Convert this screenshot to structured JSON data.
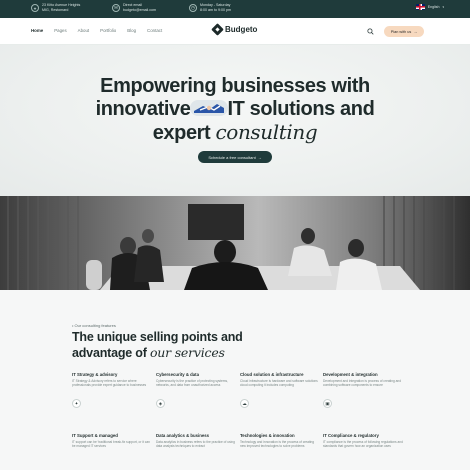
{
  "topbar": {
    "address_line1": "23 Kitto Avenue Heights",
    "address_line2": "MIG, Restomard",
    "email_label": "Direct email",
    "email_value": "budgeto@email.com",
    "hours_label": "Monday - Saturday",
    "hours_value": "8:00 am to 9:00 pm",
    "language": "English"
  },
  "nav": {
    "links": [
      "Home",
      "Pages",
      "About",
      "Portfolio",
      "Blog",
      "Contact"
    ],
    "brand": "Budgeto",
    "cta_label": "Plan with us"
  },
  "hero": {
    "title_line1": "Empowering businesses with",
    "title_line2_a": "innovative",
    "title_line2_b": "IT solutions and",
    "title_line3_a": "expert",
    "title_line3_b": "consulting",
    "button_label": "Schedule a free consultant"
  },
  "features": {
    "eyebrow": "• Our consulting features",
    "title_line1": "The unique selling points and",
    "title_line2_a": "advantage of",
    "title_line2_b": "our services",
    "cards": [
      {
        "title": "IT Strategy & advisory",
        "desc": "IT Strategy & Advisory refers to service where professionals provide expert guidance to businesses",
        "icon": "lightbulb-icon"
      },
      {
        "title": "Cybersecurity & data",
        "desc": "Cybersecurity is the practice of protecting systems, networks, and data from unauthorized access",
        "icon": "shield-icon"
      },
      {
        "title": "Cloud solution & infrastructure",
        "desc": "Cloud infrastructure is hardware and software solutions cloud computing it includes computing",
        "icon": "cloud-icon"
      },
      {
        "title": "Development & integration",
        "desc": "Development and integration is process of creating and combining software components to ensure",
        "icon": "code-icon"
      },
      {
        "title": "IT Support & managed",
        "desc": "IT support can be ‘traditional break-fix support, or it can be managed IT services",
        "icon": "headset-icon"
      },
      {
        "title": "Data analytics & business",
        "desc": "Data analytics in business refers to the practice of using data analysis techniques to extract",
        "icon": "chart-icon"
      },
      {
        "title": "Technologies & innovation",
        "desc": "Technology and innovation is the process of creating new improved technologies to solve problems",
        "icon": "gear-icon"
      },
      {
        "title": "IT Compliance & regulatory",
        "desc": "IT compliance is the process of following regulations and standards that govern how an organization uses",
        "icon": "document-icon"
      }
    ]
  },
  "colors": {
    "dark": "#1f3b3b",
    "accent": "#f7d9bf",
    "hero_bg": "#edf0ef",
    "section_bg": "#f6f7f7"
  }
}
